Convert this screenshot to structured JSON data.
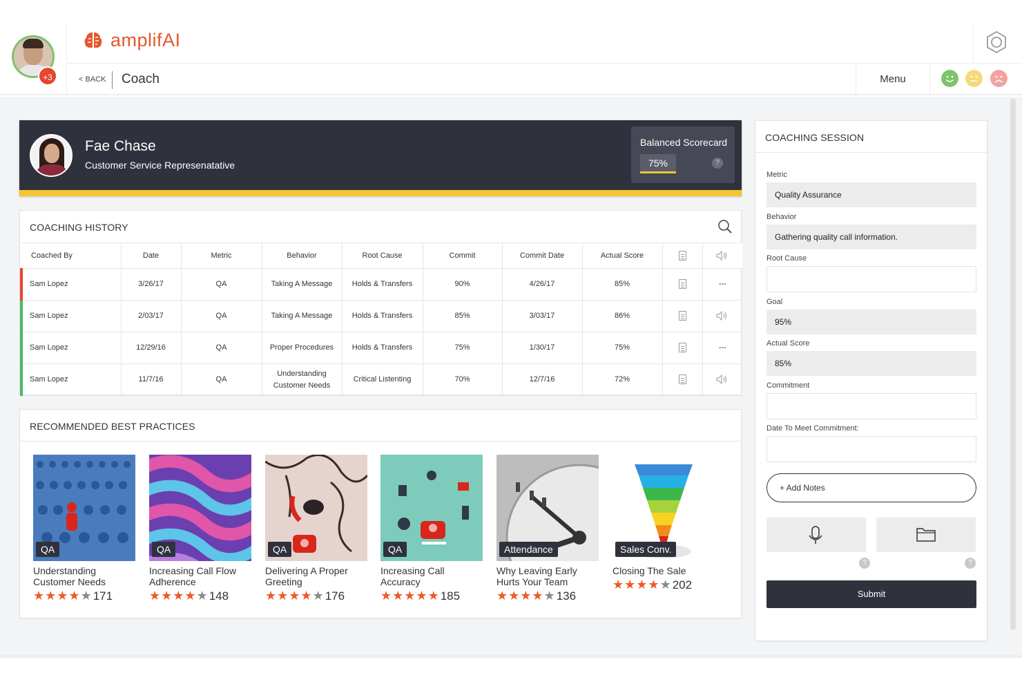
{
  "header": {
    "notification_count": "+3",
    "logo_text": "amplifAI",
    "back_label": "< BACK",
    "page_title": "Coach",
    "menu_label": "Menu",
    "mood_colors": [
      "#7cc36b",
      "#f6d97a",
      "#f2a3a0"
    ]
  },
  "profile": {
    "name": "Fae Chase",
    "role": "Customer Service Represenatative",
    "scorecard_title": "Balanced Scorecard",
    "scorecard_value": "75%",
    "help": "?"
  },
  "history": {
    "title": "COACHING HISTORY",
    "columns": [
      "Coached By",
      "Date",
      "Metric",
      "Behavior",
      "Root Cause",
      "Commit",
      "Commit Date",
      "Actual Score"
    ],
    "rows": [
      {
        "status_color": "#e8452d",
        "coached_by": "Sam Lopez",
        "date": "3/26/17",
        "metric": "QA",
        "behavior": "Taking A Message",
        "root_cause": "Holds & Transfers",
        "commit": "90%",
        "commit_date": "4/26/17",
        "actual": "85%",
        "audio": "---"
      },
      {
        "status_color": "#4cb860",
        "coached_by": "Sam Lopez",
        "date": "2/03/17",
        "metric": "QA",
        "behavior": "Taking A Message",
        "root_cause": "Holds & Transfers",
        "commit": "85%",
        "commit_date": "3/03/17",
        "actual": "86%",
        "audio": "speaker"
      },
      {
        "status_color": "#4cb860",
        "coached_by": "Sam Lopez",
        "date": "12/29/16",
        "metric": "QA",
        "behavior": "Proper Procedures",
        "root_cause": "Holds & Transfers",
        "commit": "75%",
        "commit_date": "1/30/17",
        "actual": "75%",
        "audio": "---"
      },
      {
        "status_color": "#4cb860",
        "coached_by": "Sam Lopez",
        "date": "11/7/16",
        "metric": "QA",
        "behavior": "Understanding Customer Needs",
        "root_cause": "Critical Listenting",
        "commit": "70%",
        "commit_date": "12/7/16",
        "actual": "72%",
        "audio": "speaker"
      }
    ]
  },
  "practices": {
    "title": "RECOMMENDED BEST PRACTICES",
    "cards": [
      {
        "tag": "QA",
        "title": "Understanding Customer Needs",
        "stars": 4,
        "count": "171"
      },
      {
        "tag": "QA",
        "title": "Increasing Call Flow Adherence",
        "stars": 4,
        "count": "148"
      },
      {
        "tag": "QA",
        "title": "Delivering A Proper Greeting",
        "stars": 4,
        "count": "176"
      },
      {
        "tag": "QA",
        "title": "Increasing Call Accuracy",
        "stars": 5,
        "count": "185"
      },
      {
        "tag": "Attendance",
        "title": "Why Leaving Early Hurts Your Team",
        "stars": 4,
        "count": "136"
      },
      {
        "tag": "Sales Conv.",
        "title": "Closing The Sale",
        "stars": 4,
        "count": "202"
      }
    ]
  },
  "session": {
    "title": "COACHING SESSION",
    "metric_label": "Metric",
    "metric_value": "Quality Assurance",
    "behavior_label": "Behavior",
    "behavior_value": "Gathering quality call information.",
    "root_cause_label": "Root Cause",
    "goal_label": "Goal",
    "goal_value": "95%",
    "actual_label": "Actual Score",
    "actual_value": "85%",
    "commitment_label": "Commitment",
    "date_label": "Date To Meet Commitment:",
    "add_notes": "+ Add Notes",
    "help": "?",
    "submit": "Submit"
  }
}
